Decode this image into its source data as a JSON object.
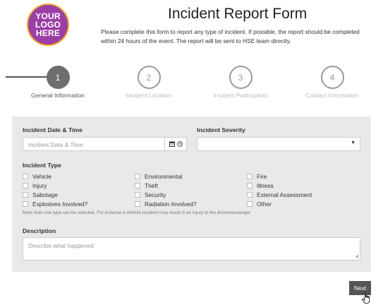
{
  "logo": {
    "line1": "YOUR",
    "line2": "LOGO",
    "line3": "HERE"
  },
  "header": {
    "title": "Incident Report Form",
    "intro": "Please complete this form to report any type of incident. If possible, the report should be completed within 24 hours of the event. The report will be sent to HSE team directly."
  },
  "stepper": {
    "steps": [
      {
        "number": "1",
        "label": "General Information",
        "active": true
      },
      {
        "number": "2",
        "label": "Incident Location",
        "active": false
      },
      {
        "number": "3",
        "label": "Incident Participants",
        "active": false
      },
      {
        "number": "4",
        "label": "Contact Information",
        "active": false
      }
    ]
  },
  "form": {
    "date_label": "Incident Date & Time",
    "date_placeholder": "Incident Date & Time",
    "severity_label": "Incident Severity",
    "severity_value": "",
    "type_label": "Incident Type",
    "types": [
      "Vehicle",
      "Environmental",
      "Fire",
      "Injury",
      "Theft",
      "Illness",
      "Sabotage",
      "Security",
      "External Assessment",
      "Explosives Involved?",
      "Radiation Involved?",
      "Other"
    ],
    "type_hint": "More than one type can be selected. For instance a Vehicle Incident may result in an injury to the driver/passenger",
    "description_label": "Description",
    "description_placeholder": "Describe what happened"
  },
  "actions": {
    "next_label": "Next"
  },
  "icons": {
    "calendar": "calendar-icon",
    "clock": "clock-icon",
    "caret": "caret-down-icon",
    "cursor": "hand-cursor-icon"
  },
  "colors": {
    "logo_bg": "#9b3fa6",
    "logo_ring": "#f0a830",
    "panel_bg": "#e9e9eb",
    "active_step": "#6e6e6e",
    "button": "#555555"
  }
}
